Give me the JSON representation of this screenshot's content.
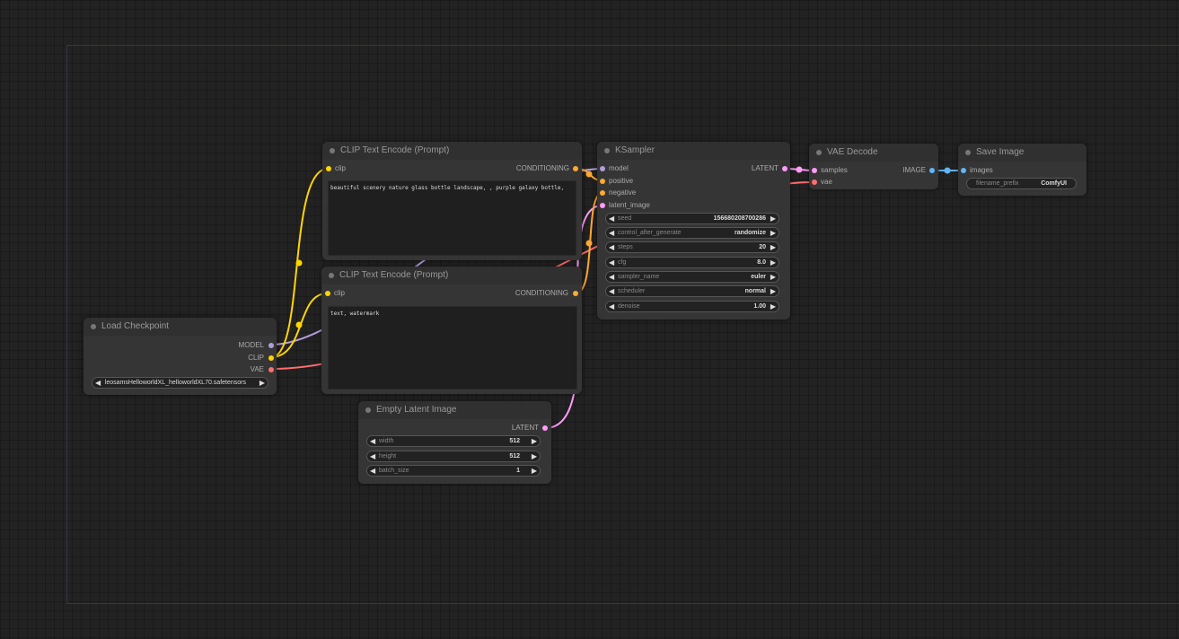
{
  "colors": {
    "clip": "#ffd500",
    "conditioning": "#ffa931",
    "model": "#b39ddb",
    "vae": "#ff6e6e",
    "latent": "#ff9cf9",
    "image": "#64b5f6",
    "canvas": "#222222",
    "node_bg": "#353535",
    "group_border": "#34364a"
  },
  "nodes": {
    "clip_pos": {
      "title": "CLIP Text Encode (Prompt)",
      "input_clip": "clip",
      "output_conditioning": "CONDITIONING",
      "text": "beautiful scenery nature glass bottle landscape, , purple galaxy bottle,"
    },
    "clip_neg": {
      "title": "CLIP Text Encode (Prompt)",
      "input_clip": "clip",
      "output_conditioning": "CONDITIONING",
      "text": "text, watermark"
    },
    "load_checkpoint": {
      "title": "Load Checkpoint",
      "output_model": "MODEL",
      "output_clip": "CLIP",
      "output_vae": "VAE",
      "ckpt_name": "leosamsHelloworldXL_helloworldXL70.safetensors"
    },
    "ksampler": {
      "title": "KSampler",
      "input_model": "model",
      "input_positive": "positive",
      "input_negative": "negative",
      "input_latent_image": "latent_image",
      "output_latent": "LATENT",
      "widgets": [
        {
          "name": "seed",
          "value": "156680208700286"
        },
        {
          "name": "control_after_generate",
          "value": "randomize"
        },
        {
          "name": "steps",
          "value": "20"
        },
        {
          "name": "cfg",
          "value": "8.0"
        },
        {
          "name": "sampler_name",
          "value": "euler"
        },
        {
          "name": "scheduler",
          "value": "normal"
        },
        {
          "name": "denoise",
          "value": "1.00"
        }
      ]
    },
    "empty_latent": {
      "title": "Empty Latent Image",
      "output_latent": "LATENT",
      "widgets": [
        {
          "name": "width",
          "value": "512"
        },
        {
          "name": "height",
          "value": "512"
        },
        {
          "name": "batch_size",
          "value": "1"
        }
      ]
    },
    "vae_decode": {
      "title": "VAE Decode",
      "input_samples": "samples",
      "input_vae": "vae",
      "output_image": "IMAGE"
    },
    "save_image": {
      "title": "Save Image",
      "input_images": "images",
      "filename_prefix_name": "filename_prefix",
      "filename_prefix_value": "ComfyUI"
    }
  },
  "icons": {
    "arrow_left": "◀",
    "arrow_right": "▶"
  }
}
